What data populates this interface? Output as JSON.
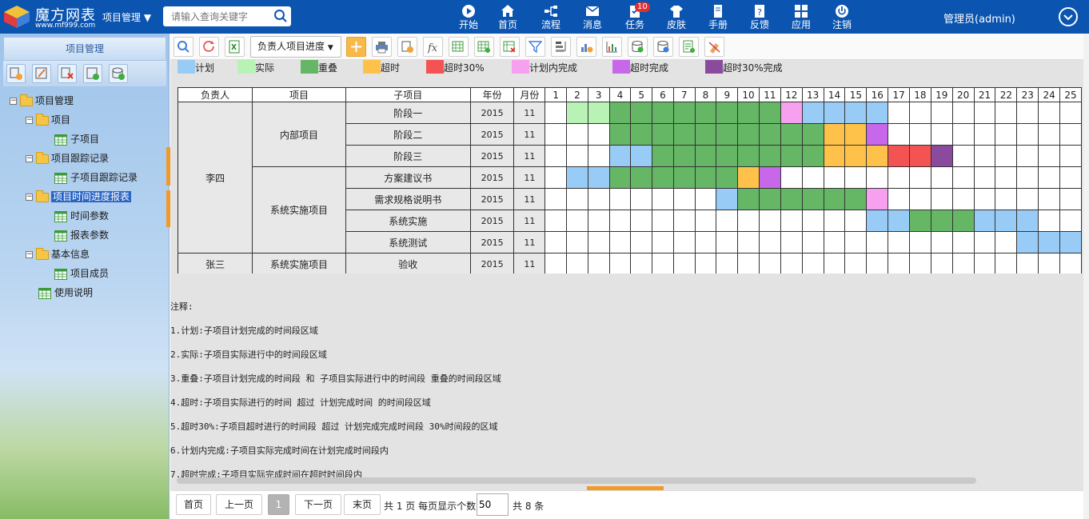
{
  "app": {
    "name": "魔方网表",
    "url": "www.mf999.com",
    "project_menu": "项目管理"
  },
  "search": {
    "placeholder": "请输入查询关键字"
  },
  "nav": [
    {
      "label": "开始",
      "icon": "play-icon"
    },
    {
      "label": "首页",
      "icon": "home-icon"
    },
    {
      "label": "流程",
      "icon": "flow-icon"
    },
    {
      "label": "消息",
      "icon": "mail-icon"
    },
    {
      "label": "任务",
      "icon": "task-icon",
      "badge": "10"
    },
    {
      "label": "皮肤",
      "icon": "shirt-icon"
    },
    {
      "label": "手册",
      "icon": "manual-icon"
    },
    {
      "label": "反馈",
      "icon": "feedback-icon"
    },
    {
      "label": "应用",
      "icon": "apps-icon"
    },
    {
      "label": "注销",
      "icon": "power-icon"
    }
  ],
  "user": {
    "name": "管理员(admin)"
  },
  "sidebar": {
    "title": "项目管理",
    "tree": [
      {
        "label": "项目管理",
        "type": "folder",
        "level": 0,
        "toggle": "−"
      },
      {
        "label": "项目",
        "type": "folder",
        "level": 1,
        "toggle": "−"
      },
      {
        "label": "子项目",
        "type": "sheet",
        "level": 2
      },
      {
        "label": "项目跟踪记录",
        "type": "folder",
        "level": 1,
        "toggle": "−"
      },
      {
        "label": "子项目跟踪记录",
        "type": "sheet",
        "level": 2
      },
      {
        "label": "项目时间进度报表",
        "type": "folder",
        "level": 1,
        "toggle": "−",
        "selected": true
      },
      {
        "label": "时间参数",
        "type": "sheet",
        "level": 2
      },
      {
        "label": "报表参数",
        "type": "sheet",
        "level": 2
      },
      {
        "label": "基本信息",
        "type": "folder",
        "level": 1,
        "toggle": "−"
      },
      {
        "label": "项目成员",
        "type": "sheet",
        "level": 2
      },
      {
        "label": "使用说明",
        "type": "sheet",
        "level": 1
      }
    ]
  },
  "toolbar": {
    "filter_label": "负责人项目进度"
  },
  "legend": [
    {
      "label": "计划",
      "color": "#98ccf7"
    },
    {
      "label": "实际",
      "color": "#b8f2b4"
    },
    {
      "label": "重叠",
      "color": "#65b765"
    },
    {
      "label": "超时",
      "color": "#fec24a"
    },
    {
      "label": "超时30%",
      "color": "#f35353"
    },
    {
      "label": "计划内完成",
      "color": "#f8a0f0"
    },
    {
      "label": "超时完成",
      "color": "#c767ea"
    },
    {
      "label": "超时30%完成",
      "color": "#8a4b9e"
    }
  ],
  "table": {
    "headers": [
      "负责人",
      "项目",
      "子项目",
      "年份",
      "月份"
    ],
    "days": [
      "1",
      "2",
      "3",
      "4",
      "5",
      "6",
      "7",
      "8",
      "9",
      "10",
      "11",
      "12",
      "13",
      "14",
      "15",
      "16",
      "17",
      "18",
      "19",
      "20",
      "21",
      "22",
      "23",
      "24",
      "25"
    ],
    "rows": [
      {
        "owner": "李四",
        "project": "内部项目",
        "sub": "阶段一",
        "year": "2015",
        "month": "11",
        "cells": "0AAOOOOOOOOPLLLL000000000"
      },
      {
        "owner": "",
        "project": "",
        "sub": "阶段二",
        "year": "2015",
        "month": "11",
        "cells": "000OOOOOOOOOOTTF000000000"
      },
      {
        "owner": "",
        "project": "",
        "sub": "阶段三",
        "year": "2015",
        "month": "11",
        "cells": "000LLOOOOOOOOTTTRRX000000"
      },
      {
        "owner": "",
        "project": "系统实施项目",
        "sub": "方案建议书",
        "year": "2015",
        "month": "11",
        "cells": "0LLOOOOOOTF00000000000000"
      },
      {
        "owner": "",
        "project": "",
        "sub": "需求规格说明书",
        "year": "2015",
        "month": "11",
        "cells": "00000000LOOOOOOP000000000"
      },
      {
        "owner": "",
        "project": "",
        "sub": "系统实施",
        "year": "2015",
        "month": "11",
        "cells": "000000000000000LLOOOLLL00"
      },
      {
        "owner": "",
        "project": "",
        "sub": "系统测试",
        "year": "2015",
        "month": "11",
        "cells": "0000000000000000000000LLL"
      },
      {
        "owner": "张三",
        "project": "系统实施项目",
        "sub": "验收",
        "year": "2015",
        "month": "11",
        "cells": "0000000000000000000000000"
      }
    ]
  },
  "notes": {
    "title": "注释:",
    "items": [
      "1.计划:子项目计划完成的时间段区域",
      "2.实际:子项目实际进行中的时间段区域",
      "3.重叠:子项目计划完成的时间段 和  子项目实际进行中的时间段 重叠的时间段区域",
      "4.超时:子项目实际进行的时间 超过 计划完成时间 的时间段区域",
      "5.超时30%:子项目超时进行的时间段 超过 计划完成完成时间段 30%时间段的区域",
      "6.计划内完成:子项目实际完成时间在计划完成时间段内",
      "7.超时完成:子项目实际完成时间在超时时间段内"
    ]
  },
  "pager": {
    "first": "首页",
    "prev": "上一页",
    "current": "1",
    "next": "下一页",
    "last": "末页",
    "info": "共 1 页 每页显示个数:",
    "page_size": "50",
    "total": "共 8 条"
  }
}
